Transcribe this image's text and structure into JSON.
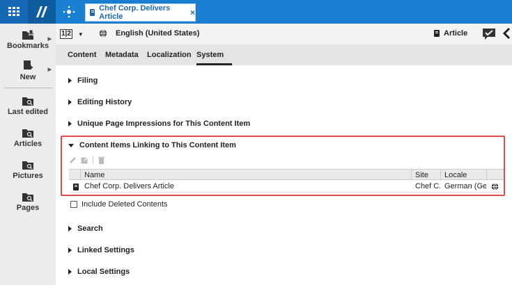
{
  "topbar": {
    "tab_title": "Chef Corp. Delivers Article",
    "close_glyph": "×",
    "icons": [
      "grid-icon",
      "studio-logo-icon",
      "satellite-icon",
      "document-icon"
    ]
  },
  "sidebar": {
    "items": [
      {
        "label": "Bookmarks",
        "icon": "bookmark-folder-icon",
        "has_arrow": true
      },
      {
        "label": "New",
        "icon": "new-document-icon",
        "has_arrow": true
      },
      {
        "label": "Last edited",
        "icon": "search-folder-icon"
      },
      {
        "label": "Articles",
        "icon": "search-folder-icon"
      },
      {
        "label": "Pictures",
        "icon": "search-folder-icon"
      },
      {
        "label": "Pages",
        "icon": "search-folder-icon"
      }
    ]
  },
  "header": {
    "version_label": "1|2",
    "locale": "English (United States)",
    "doc_type": "Article"
  },
  "tabs": [
    {
      "label": "Content"
    },
    {
      "label": "Metadata"
    },
    {
      "label": "Localization"
    },
    {
      "label": "System",
      "active": true
    }
  ],
  "sections": [
    {
      "label": "Filing",
      "expanded": false
    },
    {
      "label": "Editing History",
      "expanded": false
    },
    {
      "label": "Unique Page Impressions for This Content Item",
      "expanded": false
    },
    {
      "label": "Content Items Linking to This Content Item",
      "expanded": true
    },
    {
      "label": "Search",
      "expanded": false
    },
    {
      "label": "Linked Settings",
      "expanded": false
    },
    {
      "label": "Local Settings",
      "expanded": false
    }
  ],
  "linking_table": {
    "columns": [
      "Name",
      "Site",
      "Locale"
    ],
    "rows": [
      {
        "name": "Chef Corp. Delivers Article",
        "site": "Chef C...",
        "locale": "German (Ge..."
      }
    ],
    "include_deleted_label": "Include Deleted Contents"
  },
  "colors": {
    "topbar": "#1a7fd1",
    "highlight": "#e04a4a",
    "sidebar": "#ececec"
  }
}
